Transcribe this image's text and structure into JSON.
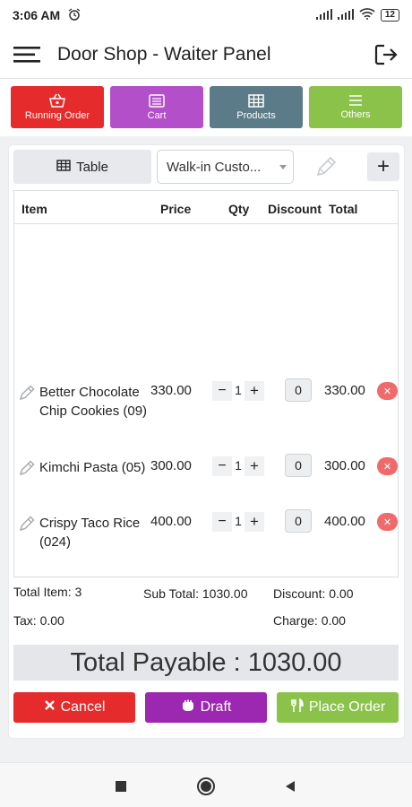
{
  "status_bar": {
    "time": "3:06 AM",
    "battery": "12"
  },
  "app_bar": {
    "title": "Door Shop - Waiter Panel"
  },
  "tabs": [
    {
      "label": "Running Order",
      "color": "#e52b2b",
      "icon": "basket-icon"
    },
    {
      "label": "Cart",
      "color": "#b24fc9",
      "icon": "list-icon"
    },
    {
      "label": "Products",
      "color": "#5c7b88",
      "icon": "grid-icon"
    },
    {
      "label": "Others",
      "color": "#8bc34a",
      "icon": "menu-icon"
    }
  ],
  "controls": {
    "table_label": "Table",
    "customer": "Walk-in Custo...",
    "add_label": "+"
  },
  "table": {
    "headers": {
      "item": "Item",
      "price": "Price",
      "qty": "Qty",
      "discount": "Discount",
      "total": "Total"
    },
    "rows": [
      {
        "name": "Better Chocolate Chip Cookies (09)",
        "price": "330.00",
        "qty": "1",
        "discount": "0",
        "total": "330.00"
      },
      {
        "name": "Kimchi Pasta (05)",
        "price": "300.00",
        "qty": "1",
        "discount": "0",
        "total": "300.00"
      },
      {
        "name": "Crispy Taco Rice (024)",
        "price": "400.00",
        "qty": "1",
        "discount": "0",
        "total": "400.00"
      }
    ]
  },
  "summary": {
    "total_item": "Total Item: 3",
    "sub_total": "Sub Total: 1030.00",
    "discount": "Discount: 0.00",
    "tax": "Tax: 0.00",
    "charge": "Charge: 0.00"
  },
  "total_payable": "Total Payable : 1030.00",
  "actions": {
    "cancel": "Cancel",
    "draft": "Draft",
    "place_order": "Place Order"
  },
  "colors": {
    "cancel": "#e52b2b",
    "draft": "#9c27b0",
    "place_order": "#8bc34a",
    "remove": "#ef6b6b"
  }
}
